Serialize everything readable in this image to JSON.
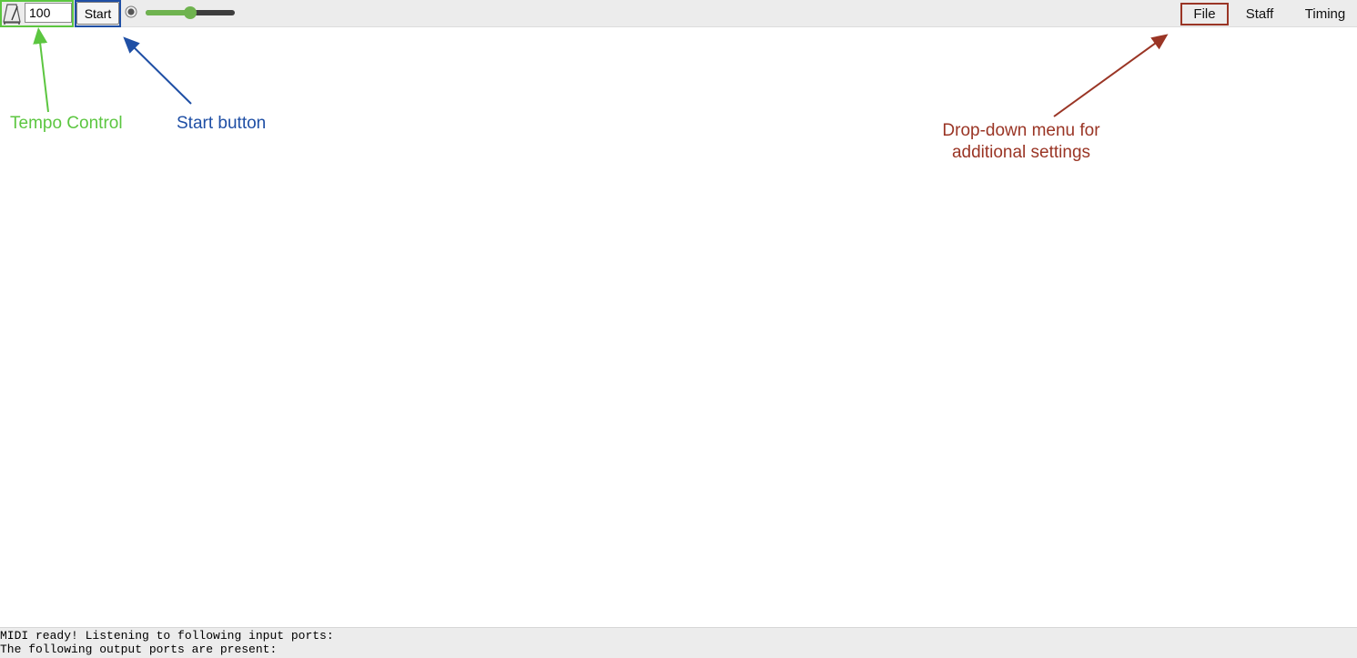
{
  "toolbar": {
    "tempo_value": "100",
    "start_label": "Start",
    "volume_level": 0.5,
    "menus": [
      "File",
      "Staff",
      "Timing"
    ]
  },
  "annotations": {
    "tempo": "Tempo Control",
    "start": "Start button",
    "menu": "Drop-down menu for additional settings"
  },
  "colors": {
    "tempo_annotation": "#5cc640",
    "start_annotation": "#1f4fa5",
    "menu_annotation": "#9a3525",
    "slider_fill": "#6fb34f"
  },
  "console": {
    "lines": [
      "MIDI ready! Listening to following input ports:",
      "The following output ports are present:"
    ]
  }
}
